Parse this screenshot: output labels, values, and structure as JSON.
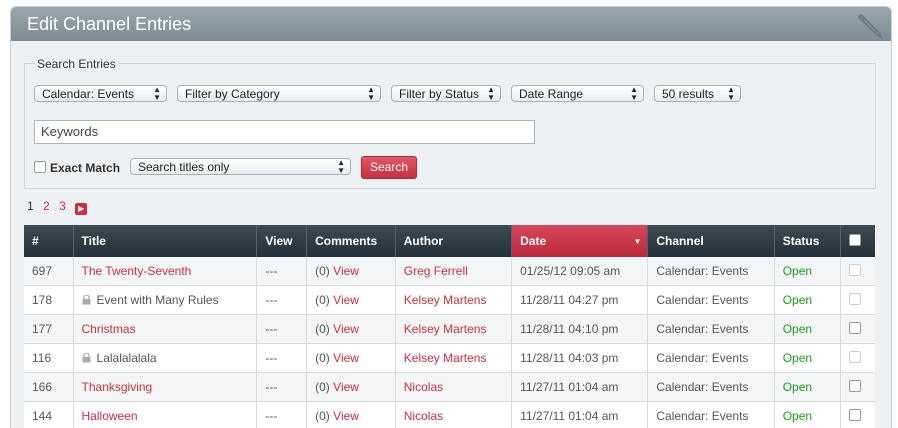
{
  "header": {
    "title": "Edit Channel Entries"
  },
  "search": {
    "legend": "Search Entries",
    "channel_filter": "Calendar: Events",
    "category_filter": "Filter by Category",
    "status_filter": "Filter by Status",
    "date_range": "Date Range",
    "results": "50 results",
    "keywords_value": "Keywords",
    "exact_match_label": "Exact Match",
    "search_in": "Search titles only",
    "search_button": "Search"
  },
  "pagination": {
    "pages": [
      "1",
      "2",
      "3"
    ],
    "current": "1"
  },
  "table": {
    "columns": [
      "#",
      "Title",
      "View",
      "Comments",
      "Author",
      "Date",
      "Channel",
      "Status"
    ],
    "sorted_column": "Date",
    "rows": [
      {
        "id": "697",
        "title": "The Twenty-Seventh",
        "locked": false,
        "view": "---",
        "comments_count": "(0)",
        "comments_link": "View",
        "author": "Greg Ferrell",
        "date": "01/25/12 09:05 am",
        "channel": "Calendar: Events",
        "status": "Open"
      },
      {
        "id": "178",
        "title": "Event with Many Rules",
        "locked": true,
        "view": "---",
        "comments_count": "(0)",
        "comments_link": "View",
        "author": "Kelsey Martens",
        "date": "11/28/11 04:27 pm",
        "channel": "Calendar: Events",
        "status": "Open"
      },
      {
        "id": "177",
        "title": "Christmas",
        "locked": false,
        "view": "---",
        "comments_count": "(0)",
        "comments_link": "View",
        "author": "Kelsey Martens",
        "date": "11/28/11 04:10 pm",
        "channel": "Calendar: Events",
        "status": "Open"
      },
      {
        "id": "116",
        "title": "Lalalalalala",
        "locked": true,
        "view": "---",
        "comments_count": "(0)",
        "comments_link": "View",
        "author": "Kelsey Martens",
        "date": "11/28/11 04:03 pm",
        "channel": "Calendar: Events",
        "status": "Open"
      },
      {
        "id": "166",
        "title": "Thanksgiving",
        "locked": false,
        "view": "---",
        "comments_count": "(0)",
        "comments_link": "View",
        "author": "Nicolas",
        "date": "11/27/11 01:04 am",
        "channel": "Calendar: Events",
        "status": "Open"
      },
      {
        "id": "144",
        "title": "Halloween",
        "locked": false,
        "view": "---",
        "comments_count": "(0)",
        "comments_link": "View",
        "author": "Nicolas",
        "date": "11/27/11 01:04 am",
        "channel": "Calendar: Events",
        "status": "Open"
      }
    ]
  },
  "colors": {
    "accent": "#c8303f",
    "open_status": "#1e9a1e",
    "header_dark": "#2d3a42"
  },
  "icons": {
    "lock": "lock-icon",
    "pencil": "pencil-icon",
    "next_page": "next-page-icon"
  }
}
